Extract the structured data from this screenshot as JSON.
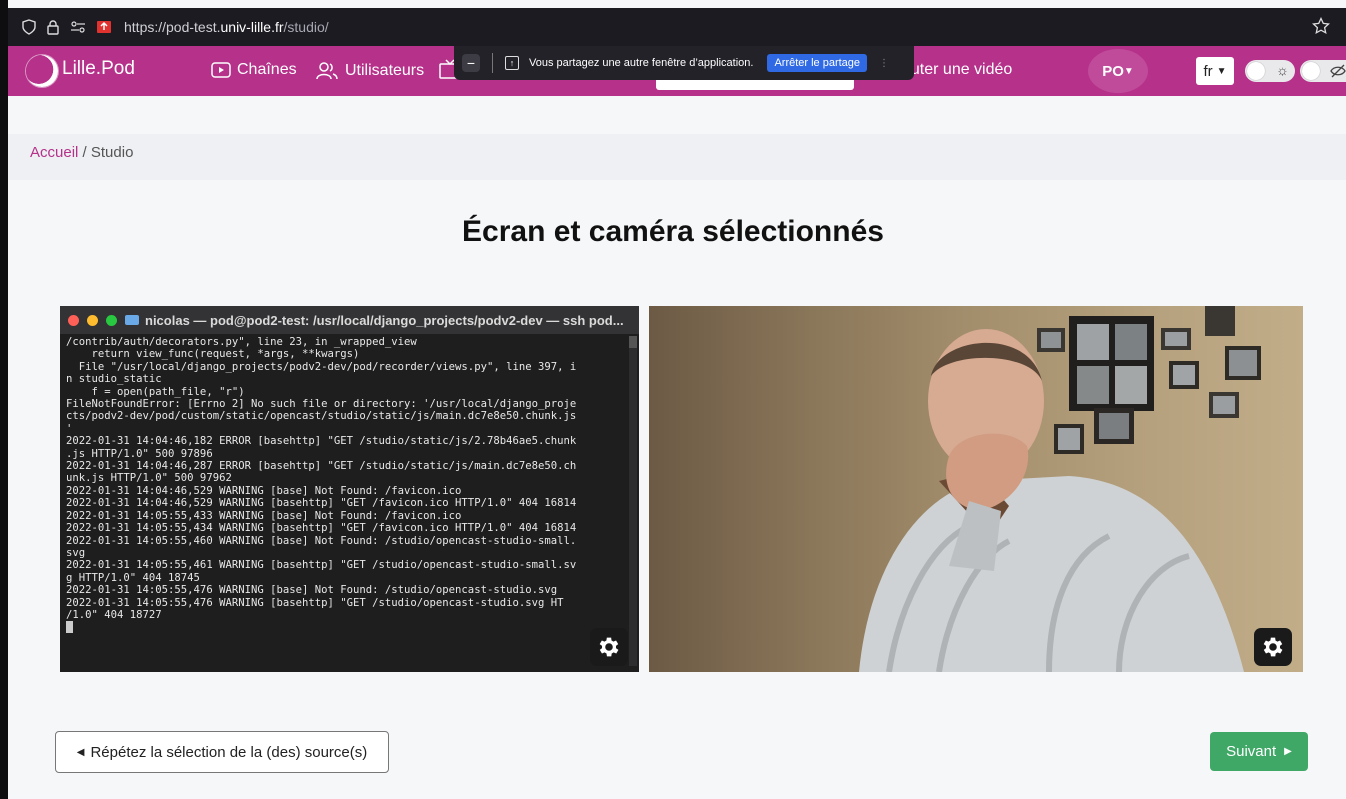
{
  "browser": {
    "url_prefix": "https://pod-test.",
    "url_domain": "univ-lille.fr",
    "url_path": "/studio/"
  },
  "navbar": {
    "brand": "Lille.Pod",
    "channels": "Chaînes",
    "users": "Utilisateurs",
    "add_video": "outer une vidéo",
    "user_initials": "PO",
    "language": "fr"
  },
  "share_bar": {
    "minimize": "−",
    "message": "Vous partagez une autre fenêtre d’application.",
    "stop_button": "Arrêter le partage"
  },
  "breadcrumb": {
    "home": "Accueil",
    "separator": "/",
    "current": "Studio"
  },
  "main": {
    "title": "Écran et caméra sélectionnés",
    "repeat_button": "Répétez la sélection de la (des) source(s)",
    "next_button": "Suivant"
  },
  "terminal": {
    "title": "nicolas — pod@pod2-test: /usr/local/django_projects/podv2-dev — ssh pod...",
    "lines": [
      "/contrib/auth/decorators.py\", line 23, in _wrapped_view",
      "    return view_func(request, *args, **kwargs)",
      "  File \"/usr/local/django_projects/podv2-dev/pod/recorder/views.py\", line 397, i",
      "n studio_static",
      "    f = open(path_file, \"r\")",
      "FileNotFoundError: [Errno 2] No such file or directory: '/usr/local/django_proje",
      "cts/podv2-dev/pod/custom/static/opencast/studio/static/js/main.dc7e8e50.chunk.js",
      "'",
      "2022-01-31 14:04:46,182 ERROR [basehttp] \"GET /studio/static/js/2.78b46ae5.chunk",
      ".js HTTP/1.0\" 500 97896",
      "2022-01-31 14:04:46,287 ERROR [basehttp] \"GET /studio/static/js/main.dc7e8e50.ch",
      "unk.js HTTP/1.0\" 500 97962",
      "2022-01-31 14:04:46,529 WARNING [base] Not Found: /favicon.ico",
      "2022-01-31 14:04:46,529 WARNING [basehttp] \"GET /favicon.ico HTTP/1.0\" 404 16814",
      "2022-01-31 14:05:55,433 WARNING [base] Not Found: /favicon.ico",
      "2022-01-31 14:05:55,434 WARNING [basehttp] \"GET /favicon.ico HTTP/1.0\" 404 16814",
      "2022-01-31 14:05:55,460 WARNING [base] Not Found: /studio/opencast-studio-small.",
      "svg",
      "2022-01-31 14:05:55,461 WARNING [basehttp] \"GET /studio/opencast-studio-small.sv",
      "g HTTP/1.0\" 404 18745",
      "2022-01-31 14:05:55,476 WARNING [base] Not Found: /studio/opencast-studio.svg",
      "2022-01-31 14:05:55,476 WARNING [basehttp] \"GET /studio/opencast-studio.svg HT",
      "/1.0\" 404 18727"
    ]
  },
  "colors": {
    "brand": "#b5318a",
    "success": "#3fa867",
    "share_stop": "#2f6ae4"
  },
  "icons": {
    "browser": [
      "shield-icon",
      "lock-icon",
      "permissions-icon",
      "screen-share-icon",
      "bookmark-star-icon"
    ],
    "navbar": [
      "play-icon",
      "users-icon",
      "tv-icon",
      "upload-icon",
      "chevron-down-icon",
      "sun-icon",
      "eye-off-icon"
    ],
    "previews": [
      "gear-icon"
    ]
  }
}
